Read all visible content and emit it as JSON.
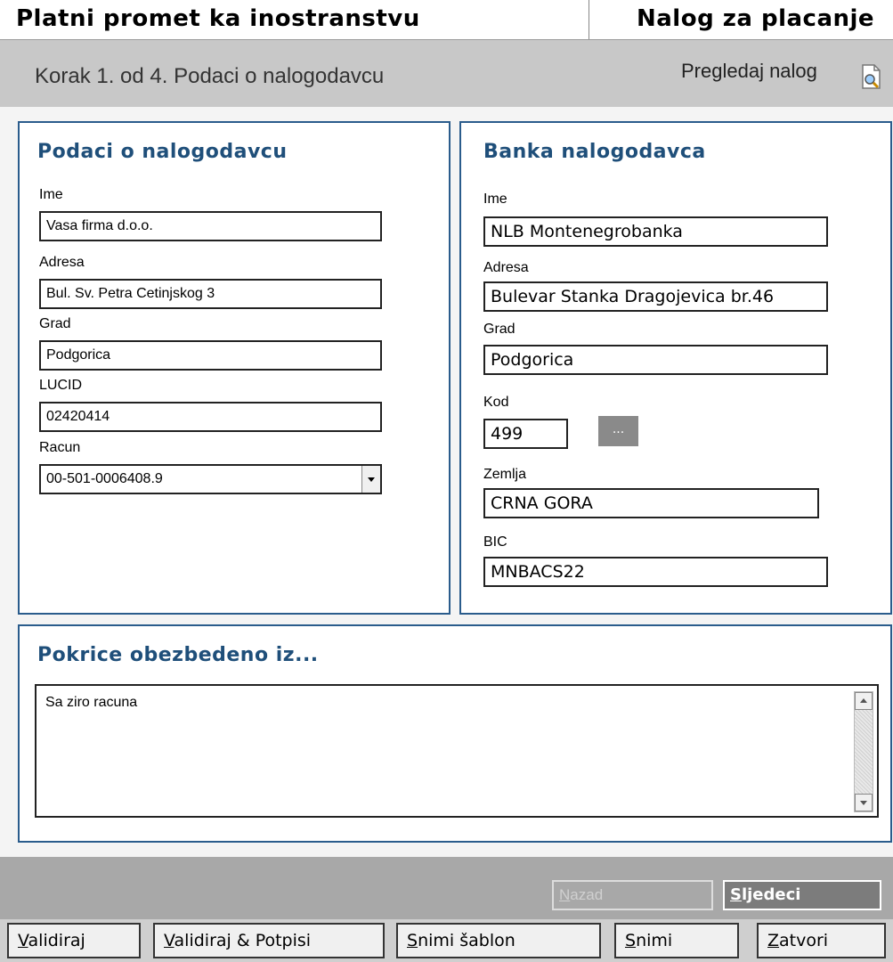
{
  "header": {
    "app_title": "Platni promet ka inostranstvu",
    "doc_title": "Nalog za placanje"
  },
  "stepbar": {
    "step_text": "Korak 1. od 4. Podaci o nalogodavcu",
    "preview_label": "Pregledaj nalog",
    "preview_icon": "document-preview-icon"
  },
  "principal": {
    "title": "Podaci o nalogodavcu",
    "name_label": "Ime",
    "name_value": "Vasa firma d.o.o.",
    "address_label": "Adresa",
    "address_value": "Bul. Sv. Petra Cetinjskog 3",
    "city_label": "Grad",
    "city_value": "Podgorica",
    "lucid_label": "LUCID",
    "lucid_value": "02420414",
    "account_label": "Racun",
    "account_value": "00-501-0006408.9"
  },
  "bank": {
    "title": "Banka nalogodavca",
    "name_label": "Ime",
    "name_value": "NLB Montenegrobanka",
    "address_label": "Adresa",
    "address_value": "Bulevar Stanka Dragojevica br.46",
    "city_label": "Grad",
    "city_value": "Podgorica",
    "code_label": "Kod",
    "code_value": "499",
    "code_lookup_label": "...",
    "country_label": "Zemlja",
    "country_value": "CRNA GORA",
    "bic_label": "BIC",
    "bic_value": "MNBACS22"
  },
  "coverage": {
    "title": "Pokrice obezbedeno iz...",
    "value": "Sa ziro racuna"
  },
  "nav": {
    "back_first": "N",
    "back_rest": "azad",
    "next_first": "S",
    "next_rest": "ljedeci"
  },
  "actions": {
    "validate_first": "V",
    "validate_rest": "alidiraj",
    "validate_sign_first": "V",
    "validate_sign_rest": "alidiraj & Potpisi",
    "save_template_first": "S",
    "save_template_rest": "nimi šablon",
    "save_first": "S",
    "save_rest": "nimi",
    "close_first": "Z",
    "close_rest": "atvori"
  },
  "colors": {
    "panel_border": "#2a5c8c",
    "panel_title": "#1f4f7a",
    "stepbar_bg": "#c8c8c8",
    "navbar_bg": "#a8a8a8"
  }
}
